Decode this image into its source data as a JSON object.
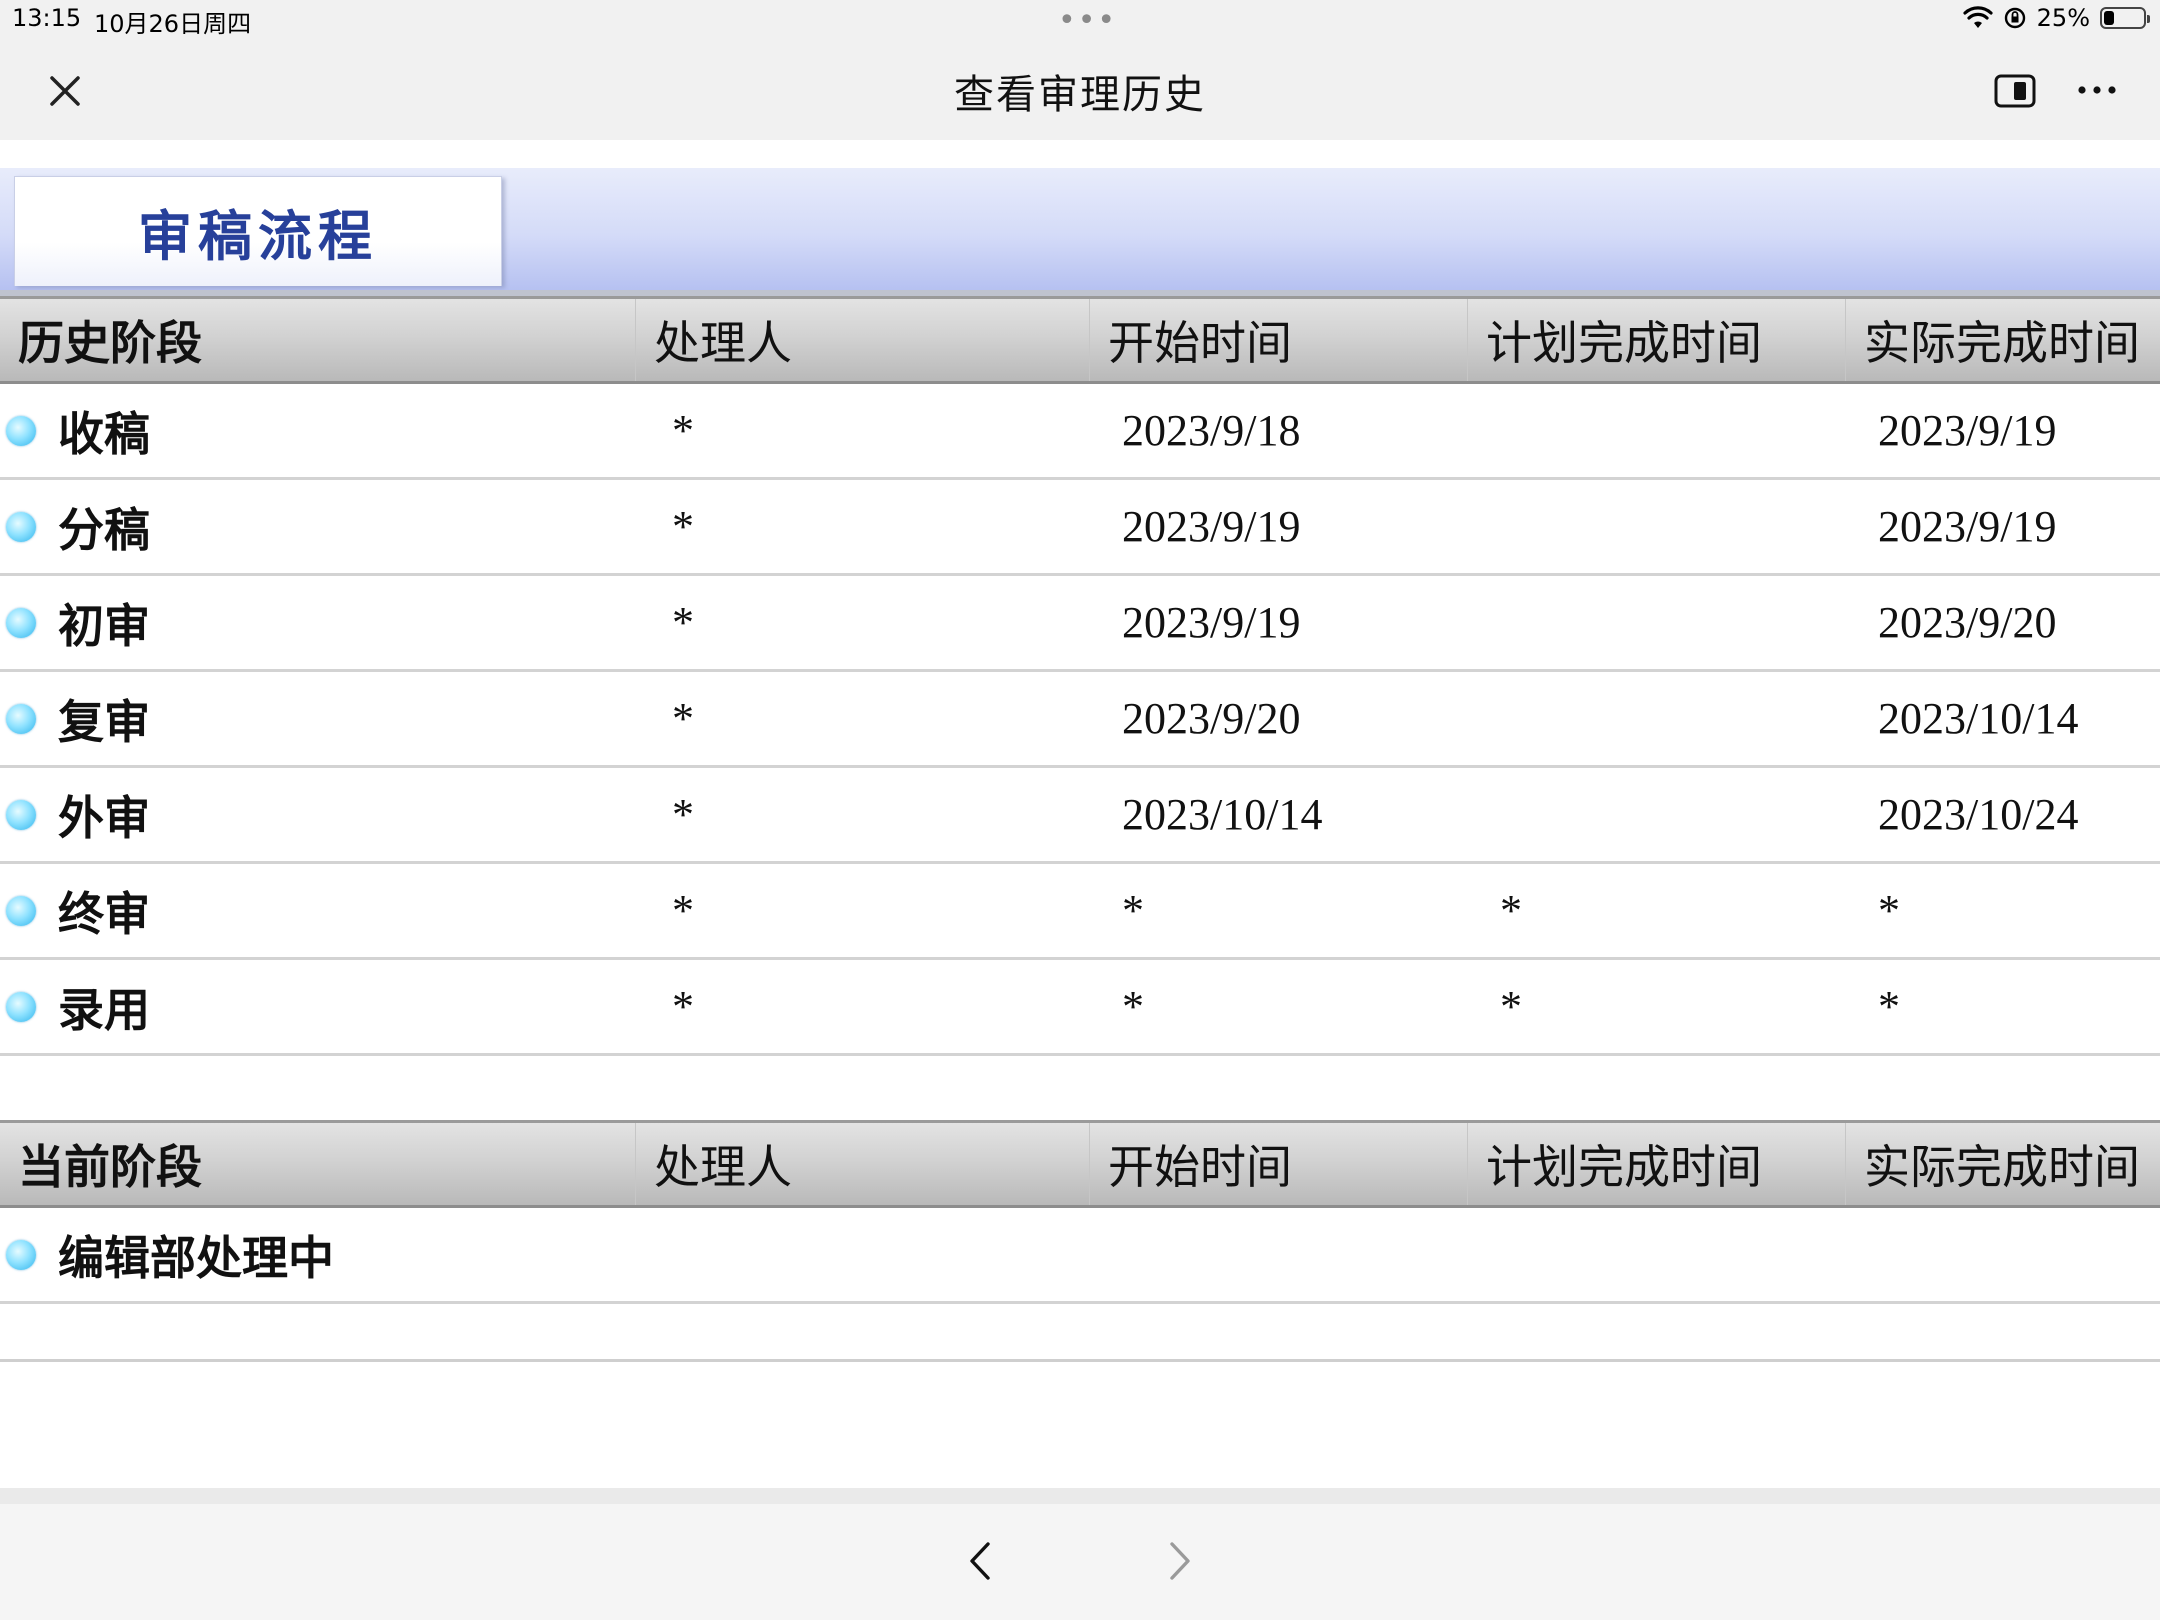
{
  "status_bar": {
    "time": "13:15",
    "date": "10月26日周四",
    "battery": "25%",
    "battery_level": 0.25
  },
  "nav": {
    "title": "查看审理历史",
    "close_icon": "close-icon",
    "split_icon": "split-view-icon",
    "more_icon": "more-icon"
  },
  "tab": {
    "label": "审稿流程"
  },
  "history": {
    "headers": [
      "历史阶段",
      "处理人",
      "开始时间",
      "计划完成时间",
      "实际完成时间"
    ],
    "rows": [
      {
        "stage": "收稿",
        "handler": "*",
        "start": "2023/9/18",
        "planned": "",
        "actual": "2023/9/19"
      },
      {
        "stage": "分稿",
        "handler": "*",
        "start": "2023/9/19",
        "planned": "",
        "actual": "2023/9/19"
      },
      {
        "stage": "初审",
        "handler": "*",
        "start": "2023/9/19",
        "planned": "",
        "actual": "2023/9/20"
      },
      {
        "stage": "复审",
        "handler": "*",
        "start": "2023/9/20",
        "planned": "",
        "actual": "2023/10/14"
      },
      {
        "stage": "外审",
        "handler": "*",
        "start": "2023/10/14",
        "planned": "",
        "actual": "2023/10/24"
      },
      {
        "stage": "终审",
        "handler": "*",
        "start": "*",
        "planned": "*",
        "actual": "*"
      },
      {
        "stage": "录用",
        "handler": "*",
        "start": "*",
        "planned": "*",
        "actual": "*"
      }
    ]
  },
  "current": {
    "headers": [
      "当前阶段",
      "处理人",
      "开始时间",
      "计划完成时间",
      "实际完成时间"
    ],
    "rows": [
      {
        "stage": "编辑部处理中",
        "handler": "",
        "start": "",
        "planned": "",
        "actual": ""
      }
    ]
  },
  "toolbar": {
    "back_icon": "chevron-left-icon",
    "forward_icon": "chevron-right-icon"
  },
  "colors": {
    "tab_text": "#27409a",
    "bullet": "#2eb4ec",
    "header_gradient_top": "#e3e3e3",
    "header_gradient_bottom": "#b9b9b9"
  }
}
